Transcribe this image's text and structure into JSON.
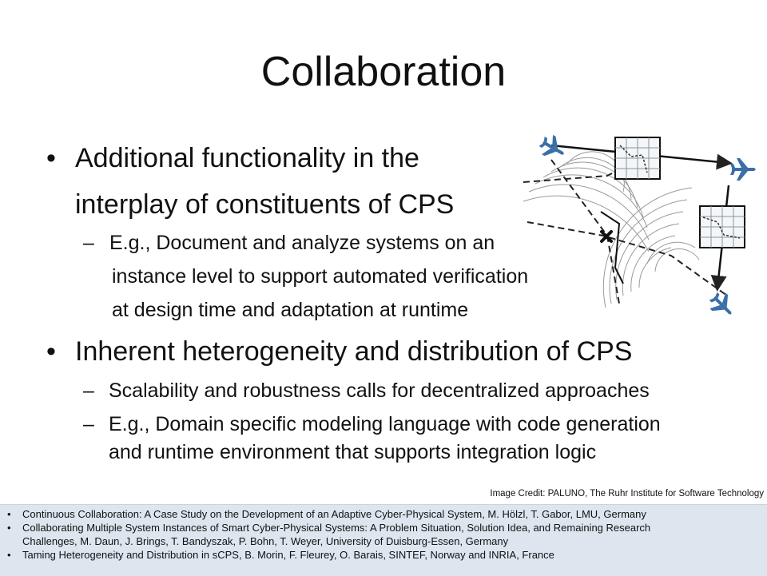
{
  "slide": {
    "title": "Collaboration",
    "bullets": [
      {
        "text_lines": [
          "Additional functionality in the",
          "interplay of constituents of CPS"
        ],
        "subitems": [
          {
            "lines": [
              "E.g., Document and analyze systems on an",
              "instance level to support automated verification",
              "at design time and adaptation at runtime"
            ]
          }
        ]
      },
      {
        "text_lines": [
          "Inherent heterogeneity and distribution of CPS"
        ],
        "subitems": [
          {
            "lines": [
              "Scalability and robustness calls for decentralized approaches"
            ]
          },
          {
            "lines": [
              "E.g., Domain specific modeling language with code generation",
              "and runtime environment that supports integration logic"
            ]
          }
        ]
      }
    ],
    "bullet_symbol": "•",
    "dash_symbol": "–",
    "image_credit": "Image Credit: PALUNO, The Ruhr Institute for Software Technology"
  },
  "references": [
    {
      "lines": [
        "Continuous Collaboration: A Case Study on the Development of an Adaptive Cyber-Physical System, M. Hölzl, T. Gabor, LMU, Germany"
      ]
    },
    {
      "lines": [
        "Collaborating Multiple System Instances of Smart Cyber-Physical Systems: A Problem Situation, Solution Idea, and Remaining Research",
        "Challenges, M. Daun, J. Brings, T. Bandyszak, P. Bohn, T. Weyer, University of Duisburg-Essen, Germany"
      ]
    },
    {
      "lines": [
        "Taming Heterogeneity and Distribution in sCPS, B. Morin, F. Fleurey, O. Barais, SINTEF, Norway and INRIA, France"
      ]
    }
  ],
  "diagram": {
    "icons": [
      "airplane-icon",
      "airplane-icon",
      "airplane-icon",
      "map-tile-icon",
      "map-tile-icon",
      "collision-x-icon"
    ],
    "colors": {
      "airplane": "#3a6fa8",
      "lines": "#222222",
      "arcs": "#9a9a9a"
    }
  }
}
